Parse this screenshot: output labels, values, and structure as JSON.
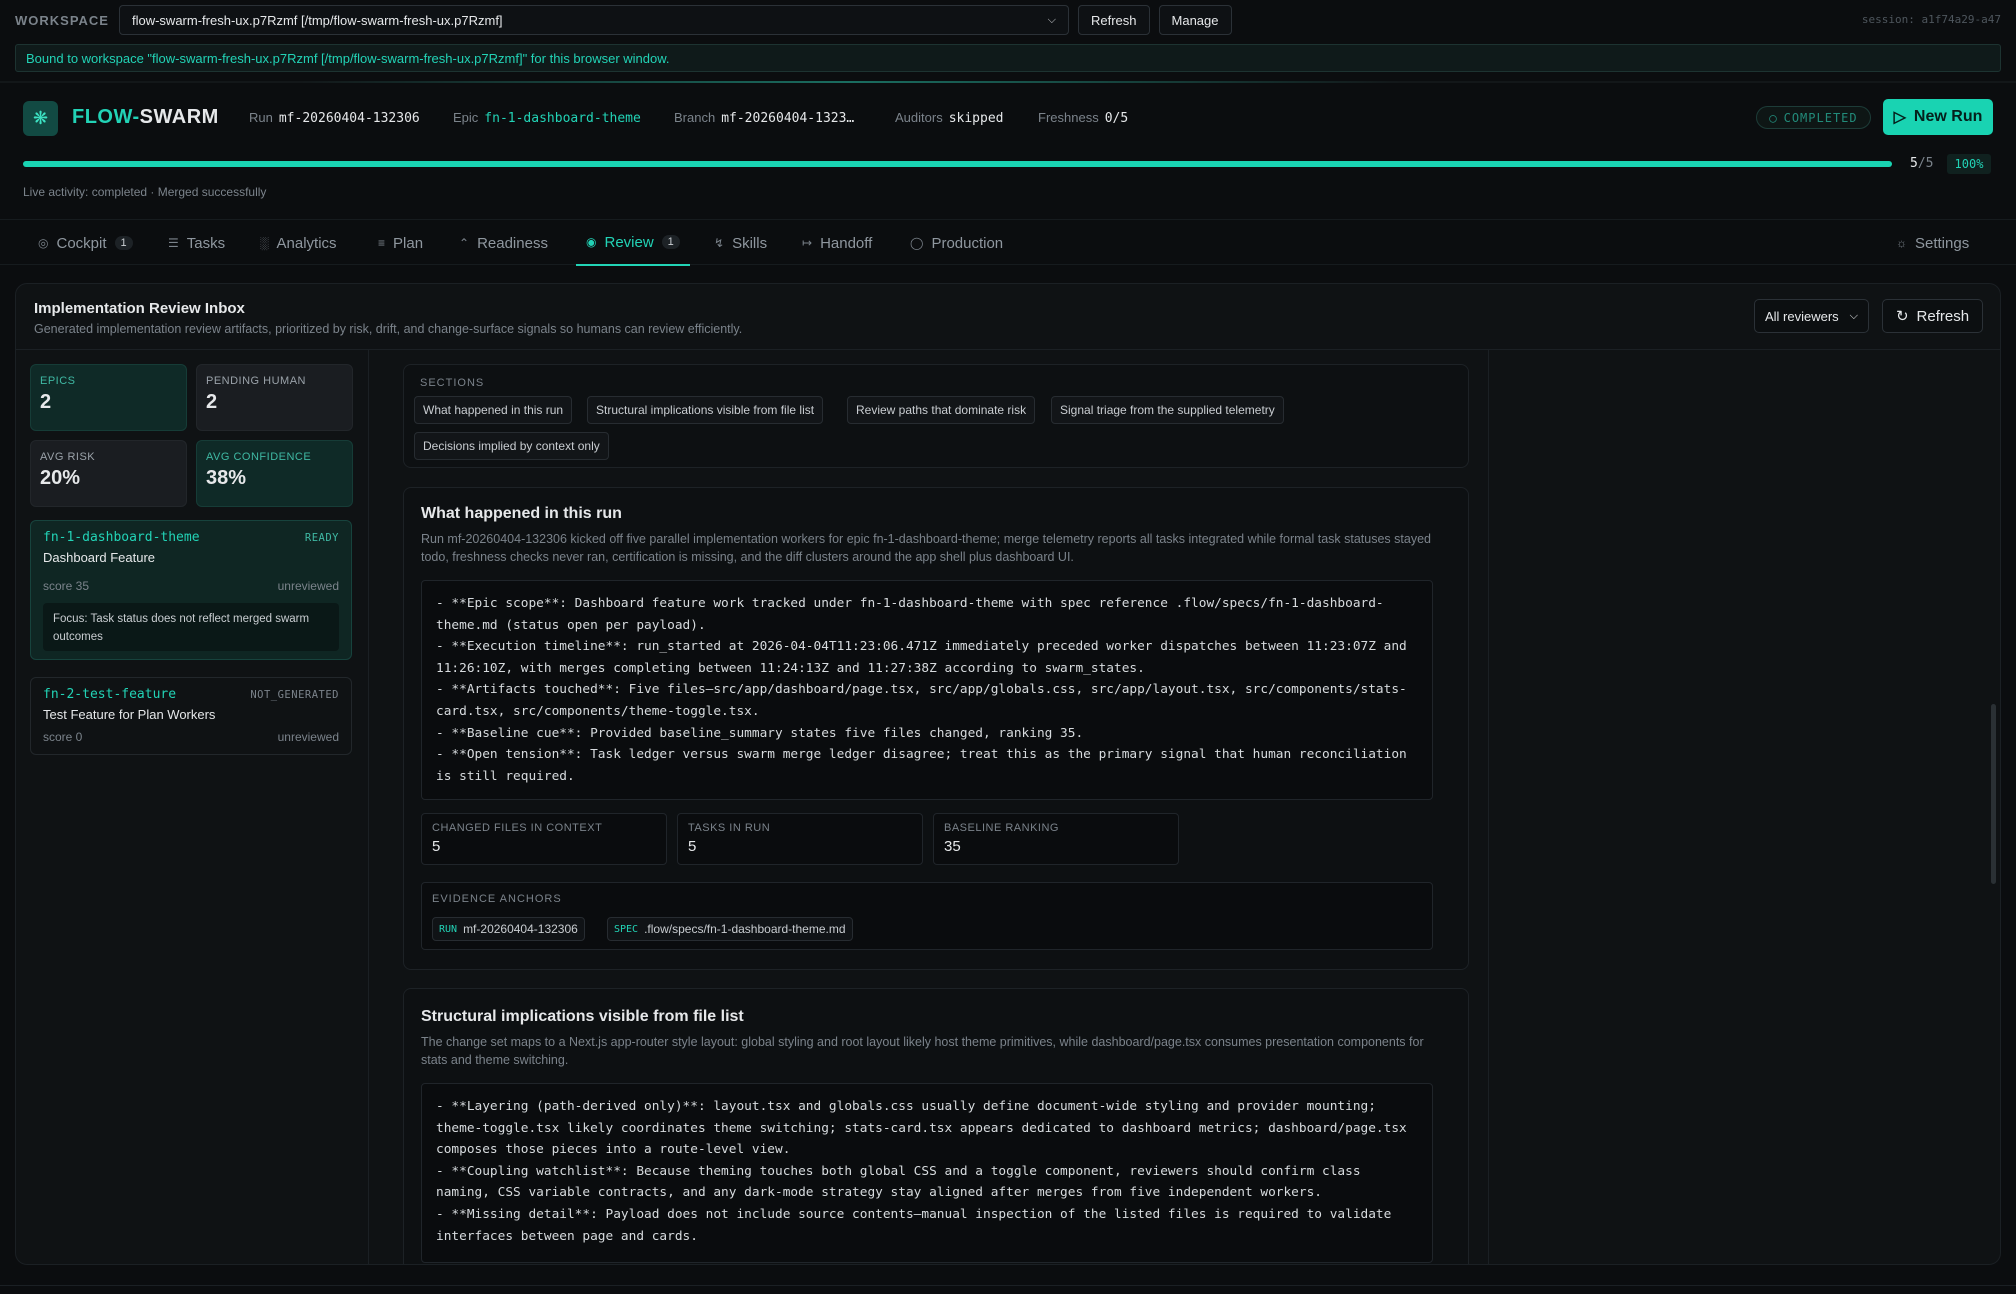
{
  "workspace": {
    "label": "WORKSPACE",
    "selected": "flow-swarm-fresh-ux.p7Rzmf [/tmp/flow-swarm-fresh-ux.p7Rzmf]",
    "refresh_label": "Refresh",
    "manage_label": "Manage",
    "session": "session: a1f74a29-a47",
    "bound_message": "Bound to workspace \"flow-swarm-fresh-ux.p7Rzmf [/tmp/flow-swarm-fresh-ux.p7Rzmf]\" for this browser window."
  },
  "brand": {
    "part1": "FLOW",
    "sep": "-",
    "part2": "SWARM"
  },
  "run": {
    "run_label": "Run",
    "run_value": "mf-20260404-132306",
    "epic_label": "Epic",
    "epic_value": "fn-1-dashboard-theme",
    "branch_label": "Branch",
    "branch_value": "mf-20260404-1323…",
    "auditors_label": "Auditors",
    "auditors_value": "skipped",
    "freshness_label": "Freshness",
    "freshness_value": "0/5",
    "status": "COMPLETED",
    "new_run_label": "New Run",
    "progress_fraction": 1.0,
    "progress_done": "5",
    "progress_total": "/5",
    "progress_pct": "100%",
    "live_activity": "Live activity: completed · Merged successfully"
  },
  "tabs": [
    {
      "label": "Cockpit",
      "badge": "1"
    },
    {
      "label": "Tasks"
    },
    {
      "label": "Analytics"
    },
    {
      "label": "Plan"
    },
    {
      "label": "Readiness"
    },
    {
      "label": "Review",
      "badge": "1"
    },
    {
      "label": "Skills"
    },
    {
      "label": "Handoff"
    },
    {
      "label": "Production"
    },
    {
      "label": "Settings"
    }
  ],
  "panel": {
    "title": "Implementation Review Inbox",
    "subtitle": "Generated implementation review artifacts, prioritized by risk, drift, and change-surface signals so humans can review efficiently.",
    "reviewer_filter": "All reviewers",
    "refresh_label": "Refresh"
  },
  "stats": [
    {
      "label": "EPICS",
      "value": "2"
    },
    {
      "label": "PENDING HUMAN",
      "value": "2"
    },
    {
      "label": "AVG RISK",
      "value": "20%"
    },
    {
      "label": "AVG CONFIDENCE",
      "value": "38%"
    }
  ],
  "epics": [
    {
      "id": "fn-1-dashboard-theme",
      "status": "READY",
      "name": "Dashboard Feature",
      "score": "score 35",
      "review": "unreviewed",
      "focus": "Focus: Task status does not reflect merged swarm outcomes"
    },
    {
      "id": "fn-2-test-feature",
      "status": "NOT_GENERATED",
      "name": "Test Feature for Plan Workers",
      "score": "score 0",
      "review": "unreviewed"
    }
  ],
  "sections": {
    "label": "SECTIONS",
    "chips": [
      "What happened in this run",
      "Structural implications visible from file list",
      "Review paths that dominate risk",
      "Signal triage from the supplied telemetry",
      "Decisions implied by context only"
    ]
  },
  "section1": {
    "title": "What happened in this run",
    "desc": "Run mf-20260404-132306 kicked off five parallel implementation workers for epic fn-1-dashboard-theme; merge telemetry reports all tasks integrated while formal task statuses stayed todo, freshness checks never ran, certification is missing, and the diff clusters around the app shell plus dashboard UI.",
    "body": "- **Epic scope**: Dashboard feature work tracked under fn-1-dashboard-theme with spec reference .flow/specs/fn-1-dashboard-theme.md (status open per payload).\n- **Execution timeline**: run_started at 2026-04-04T11:23:06.471Z immediately preceded worker dispatches between 11:23:07Z and 11:26:10Z, with merges completing between 11:24:13Z and 11:27:38Z according to swarm_states.\n- **Artifacts touched**: Five files—src/app/dashboard/page.tsx, src/app/globals.css, src/app/layout.tsx, src/components/stats-card.tsx, src/components/theme-toggle.tsx.\n- **Baseline cue**: Provided baseline_summary states five files changed, ranking 35.\n- **Open tension**: Task ledger versus swarm merge ledger disagree; treat this as the primary signal that human reconciliation is still required.",
    "metrics": [
      {
        "label": "CHANGED FILES IN CONTEXT",
        "value": "5"
      },
      {
        "label": "TASKS IN RUN",
        "value": "5"
      },
      {
        "label": "BASELINE RANKING",
        "value": "35"
      }
    ],
    "anchors_label": "EVIDENCE ANCHORS",
    "anchors": [
      {
        "tag": "RUN",
        "value": "mf-20260404-132306"
      },
      {
        "tag": "SPEC",
        "value": ".flow/specs/fn-1-dashboard-theme.md"
      }
    ]
  },
  "section2": {
    "title": "Structural implications visible from file list",
    "desc": "The change set maps to a Next.js app-router style layout: global styling and root layout likely host theme primitives, while dashboard/page.tsx consumes presentation components for stats and theme switching.",
    "body": "- **Layering (path-derived only)**: layout.tsx and globals.css usually define document-wide styling and provider mounting; theme-toggle.tsx likely coordinates theme switching; stats-card.tsx appears dedicated to dashboard metrics; dashboard/page.tsx composes those pieces into a route-level view.\n- **Coupling watchlist**: Because theming touches both global CSS and a toggle component, reviewers should confirm class naming, CSS variable contracts, and any dark-mode strategy stay aligned after merges from five independent workers.\n- **Missing detail**: Payload does not include source contents—manual inspection of the listed files is required to validate interfaces between page and cards."
  }
}
